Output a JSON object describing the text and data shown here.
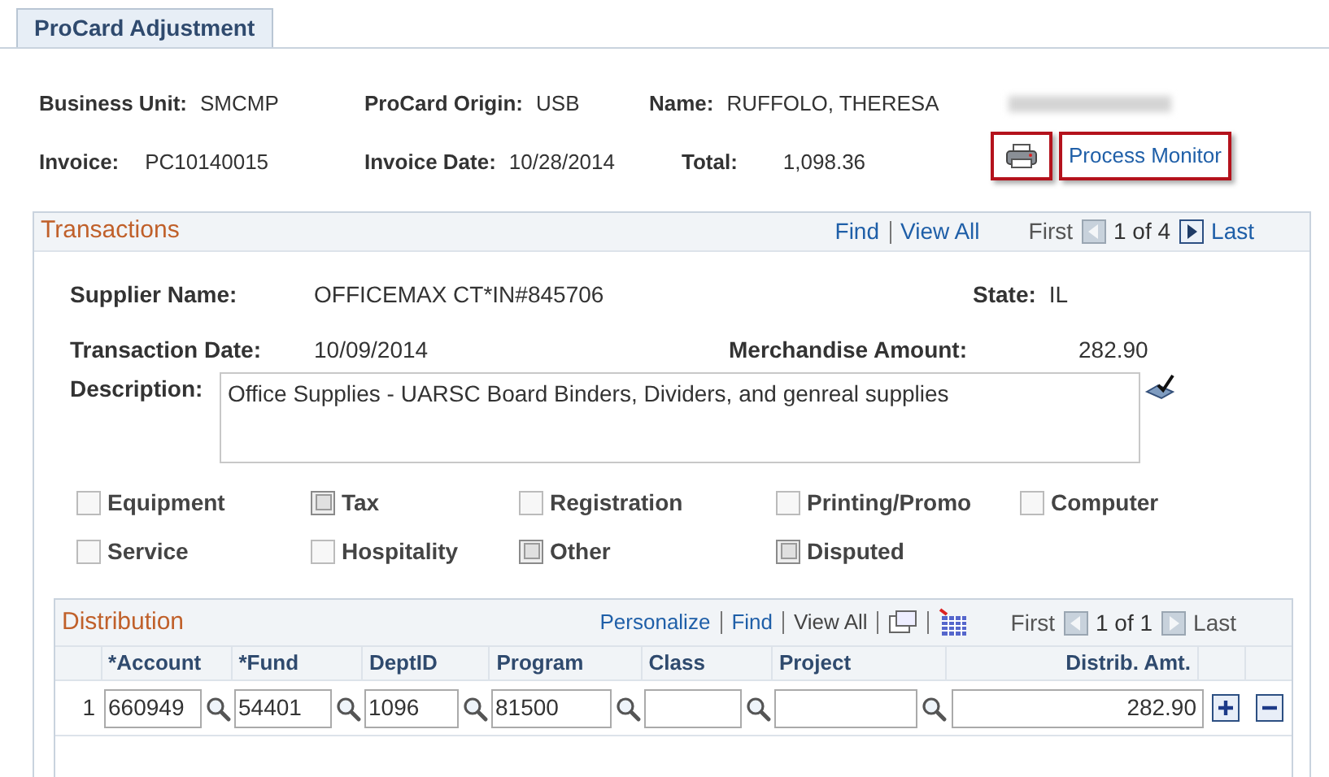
{
  "tab": {
    "label": "ProCard Adjustment",
    "selected": true
  },
  "header": [
    [
      {
        "label": "Business Unit:",
        "value": "SMCMP"
      },
      {
        "label": "ProCard Origin:",
        "value": "USB"
      },
      {
        "label": "Name:",
        "value": "RUFFOLO, THERESA"
      }
    ],
    [
      {
        "label": "Invoice:",
        "value": "PC10140015"
      },
      {
        "label": "Invoice Date:",
        "value": "10/28/2014"
      },
      {
        "label": "Total:",
        "value": "1,098.36"
      }
    ]
  ],
  "process_monitor": "Process Monitor",
  "transactions": {
    "title": "Transactions",
    "find": "Find",
    "view_all": "View All",
    "pager": {
      "first": "First",
      "count": "1 of 4",
      "last": "Last",
      "prev_enabled": false,
      "next_enabled": true
    },
    "supplier_label": "Supplier Name:",
    "supplier": "OFFICEMAX CT*IN#845706",
    "state_label": "State:",
    "state": "IL",
    "date_label": "Transaction Date:",
    "date": "10/09/2014",
    "amount_label": "Merchandise Amount:",
    "amount": "282.90",
    "description_label": "Description:",
    "description": "Office Supplies - UARSC Board Binders, Dividers, and genreal supplies",
    "checkboxes": [
      {
        "label": "Equipment",
        "checked": false,
        "disabled": false
      },
      {
        "label": "Tax",
        "checked": false,
        "disabled": true
      },
      {
        "label": "Registration",
        "checked": false,
        "disabled": false
      },
      {
        "label": "Printing/Promo",
        "checked": false,
        "disabled": false
      },
      {
        "label": "Computer",
        "checked": false,
        "disabled": false
      },
      {
        "label": "Service",
        "checked": false,
        "disabled": false
      },
      {
        "label": "Hospitality",
        "checked": false,
        "disabled": false
      },
      {
        "label": "Other",
        "checked": false,
        "disabled": true
      },
      {
        "label": "Disputed",
        "checked": false,
        "disabled": true
      }
    ]
  },
  "distribution": {
    "title": "Distribution",
    "links": [
      "Personalize",
      "Find"
    ],
    "view_all": "View All",
    "pager": {
      "first": "First",
      "count": "1 of 1",
      "last": "Last",
      "prev_enabled": false,
      "next_enabled": false
    },
    "columns": [
      "*Account",
      "*Fund",
      "DeptID",
      "Program",
      "Class",
      "Project",
      "Distrib. Amt."
    ],
    "rows": [
      {
        "num": "1",
        "cells": [
          "660949",
          "54401",
          "1096",
          "81500",
          "",
          ""
        ],
        "amount": "282.90"
      }
    ]
  }
}
